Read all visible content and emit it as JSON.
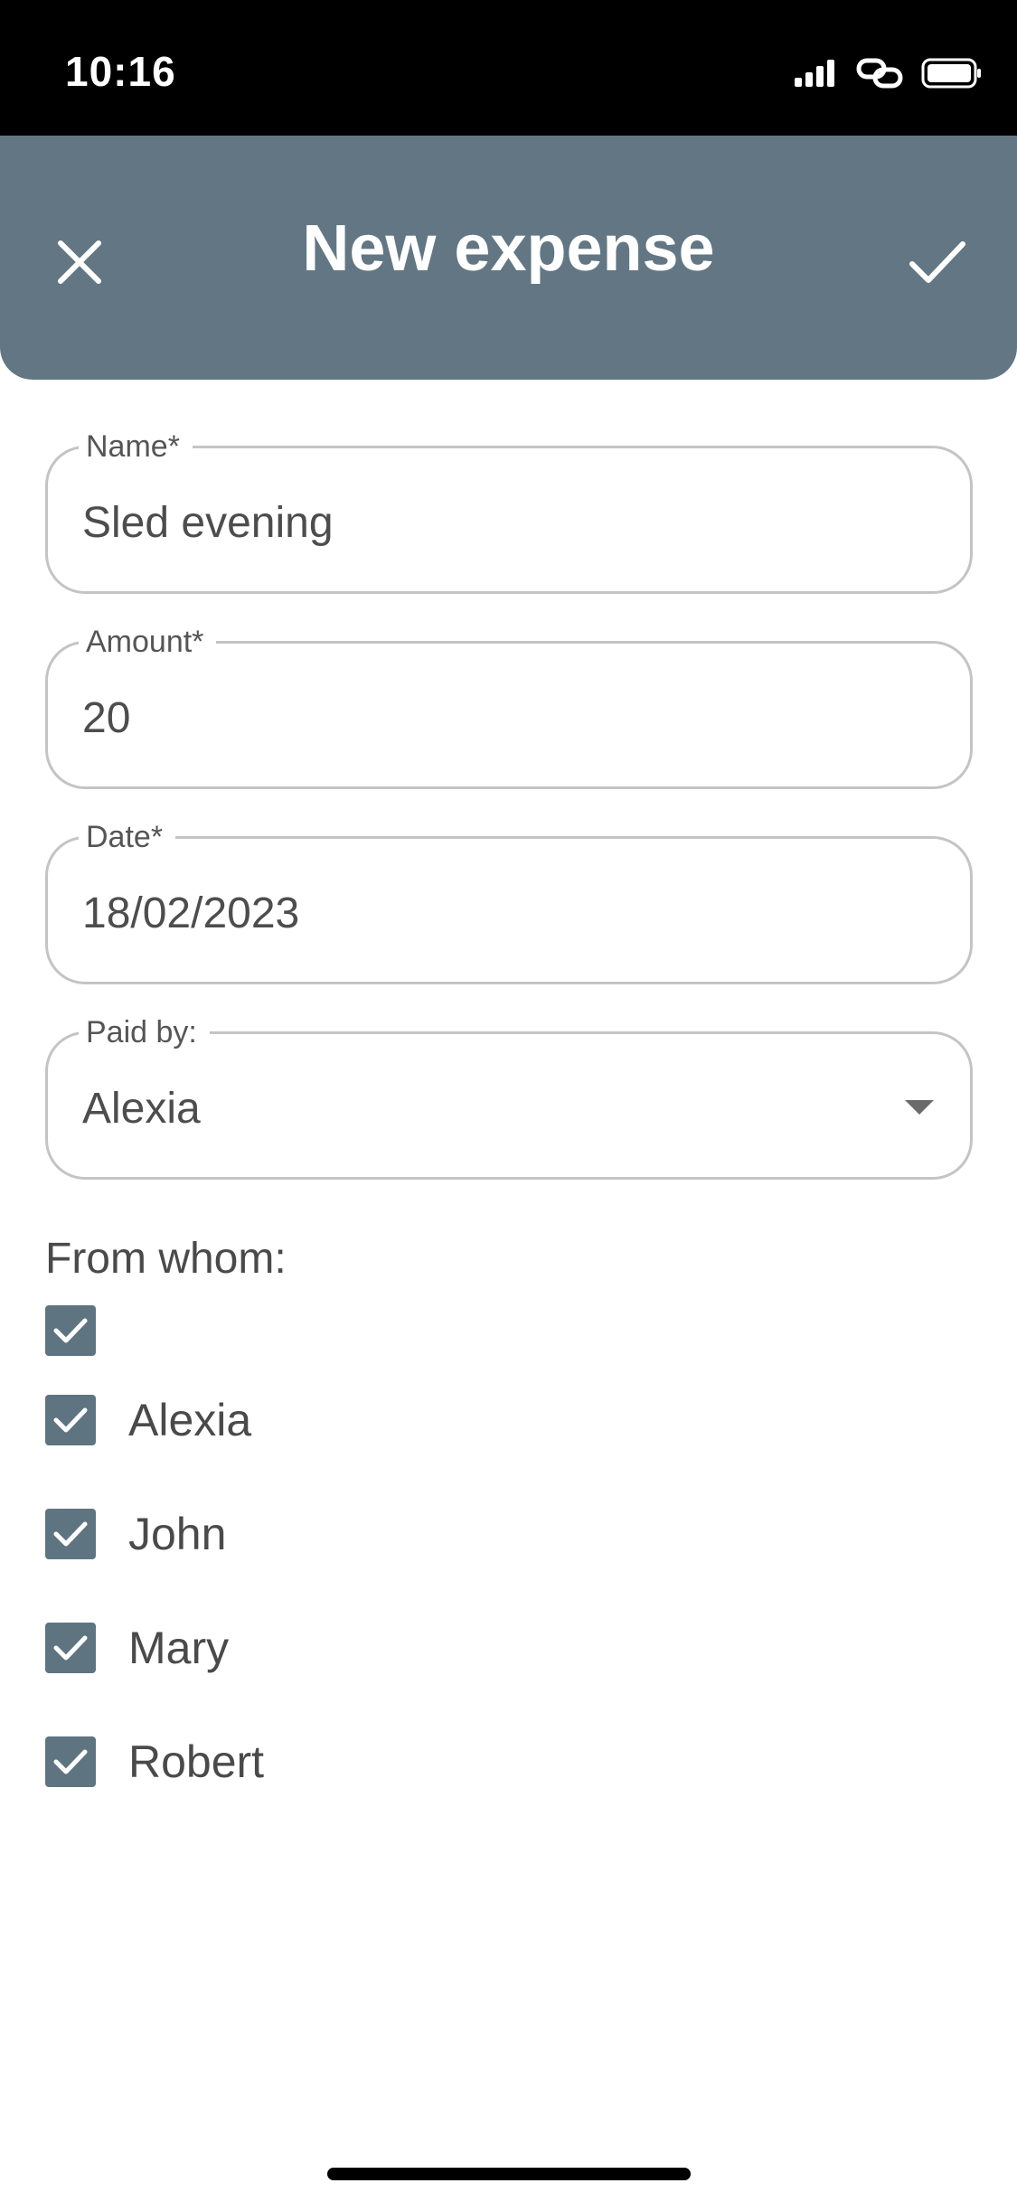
{
  "status_bar": {
    "time": "10:16"
  },
  "header": {
    "title": "New expense",
    "close_icon": "close-icon",
    "confirm_icon": "check-icon"
  },
  "form": {
    "name": {
      "label": "Name*",
      "value": "Sled evening"
    },
    "amount": {
      "label": "Amount*",
      "value": "20"
    },
    "date": {
      "label": "Date*",
      "value": "18/02/2023"
    },
    "paid_by": {
      "label": "Paid by:",
      "value": "Alexia"
    }
  },
  "from_whom": {
    "label": "From whom:",
    "select_all_checked": true,
    "people": [
      {
        "name": "Alexia",
        "checked": true
      },
      {
        "name": "John",
        "checked": true
      },
      {
        "name": "Mary",
        "checked": true
      },
      {
        "name": "Robert",
        "checked": true
      }
    ]
  },
  "colors": {
    "header_bg": "#627783",
    "checkbox_bg": "#5f7481"
  }
}
